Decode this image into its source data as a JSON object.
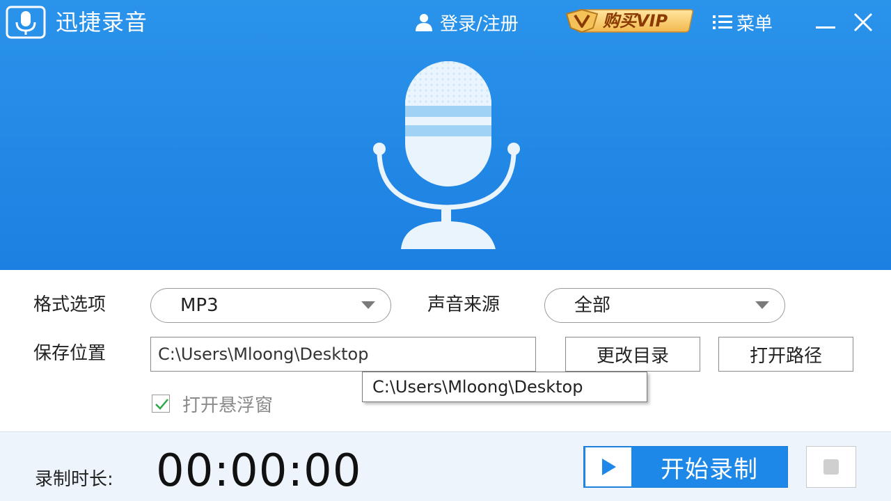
{
  "app": {
    "title": "迅捷录音",
    "logo_icon": "microphone-logo-icon"
  },
  "titlebar": {
    "login_label": "登录/注册",
    "login_icon": "user-icon",
    "vip_label": "购买VIP",
    "vip_icon": "vip-crown-icon",
    "menu_label": "菜单",
    "menu_icon": "menu-list-icon",
    "minimize_icon": "minimize-icon",
    "close_icon": "close-icon"
  },
  "hero": {
    "illustration": "microphone-illustration"
  },
  "settings": {
    "format_label": "格式选项",
    "format_value": "MP3",
    "source_label": "声音来源",
    "source_value": "全部",
    "save_label": "保存位置",
    "save_path": "C:\\Users\\Mloong\\Desktop",
    "change_dir_label": "更改目录",
    "open_path_label": "打开路径",
    "tooltip_text": "C:\\Users\\Mloong\\Desktop",
    "floating_window_label": "打开悬浮窗",
    "floating_window_checked": true
  },
  "footer": {
    "duration_label": "录制时长:",
    "duration_value": "00:00:00",
    "start_label": "开始录制",
    "start_icon": "play-icon",
    "stop_icon": "stop-icon"
  },
  "colors": {
    "header_blue": "#1f86e6",
    "accent_blue": "#1e88e8",
    "vip_gold": "#f4c060",
    "check_green": "#2aa84a"
  }
}
